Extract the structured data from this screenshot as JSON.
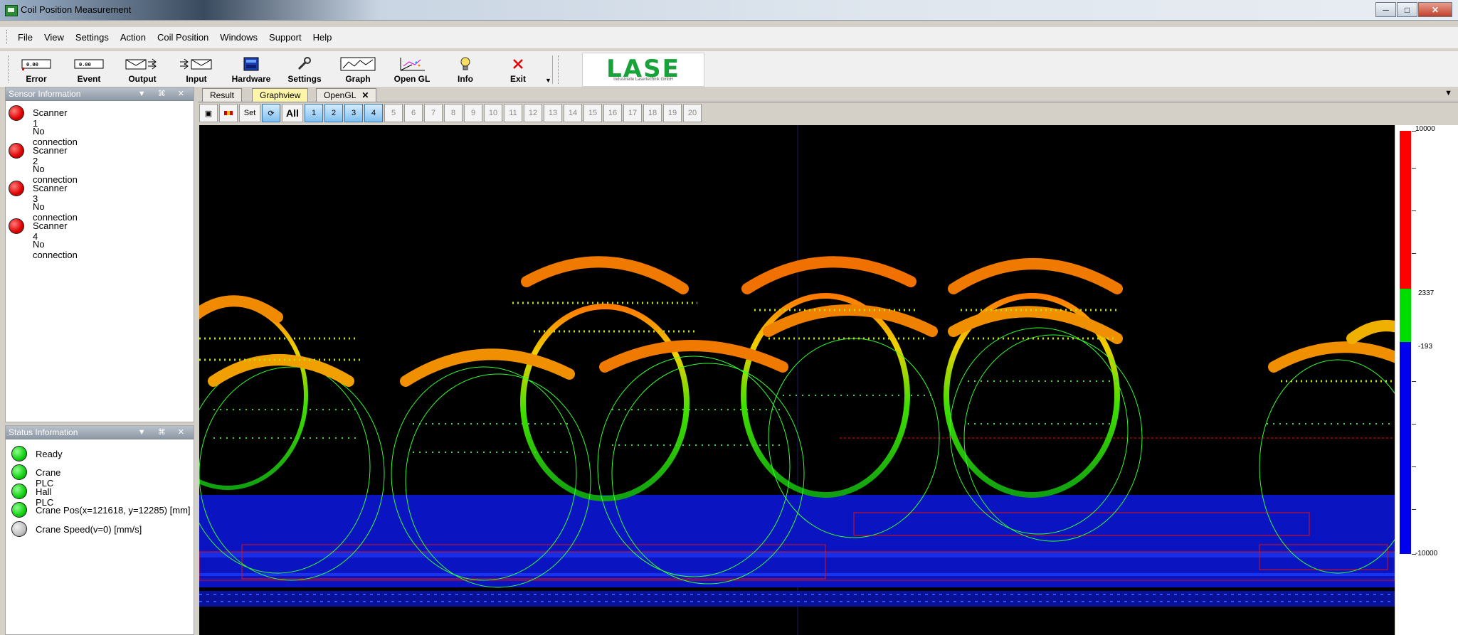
{
  "window": {
    "title": "Coil Position Measurement"
  },
  "menu": [
    "File",
    "View",
    "Settings",
    "Action",
    "Coil Position",
    "Windows",
    "Support",
    "Help"
  ],
  "toolbar": {
    "error": "Error",
    "event": "Event",
    "output": "Output",
    "input": "Input",
    "hardware": "Hardware",
    "settings": "Settings",
    "graph": "Graph",
    "opengl": "Open GL",
    "info": "Info",
    "exit": "Exit"
  },
  "logo": {
    "text": "LASE",
    "sub": "Industrielle Lasertechnik GmbH"
  },
  "sensor_panel": {
    "title": "Sensor Information",
    "scanners": [
      {
        "name": "Scanner 1",
        "status": "No connection"
      },
      {
        "name": "Scanner 2",
        "status": "No connection"
      },
      {
        "name": "Scanner 3",
        "status": "No connection"
      },
      {
        "name": "Scanner 4",
        "status": "No connection"
      }
    ]
  },
  "status_panel": {
    "title": "Status Information",
    "items": [
      {
        "label": "Ready",
        "state": "green"
      },
      {
        "label": "Crane PLC",
        "state": "green"
      },
      {
        "label": "Hall PLC",
        "state": "green"
      },
      {
        "label": "Crane Pos(x=121618, y=12285) [mm]",
        "state": "green"
      },
      {
        "label": "Crane Speed(v=0) [mm/s]",
        "state": "gray"
      }
    ]
  },
  "tabs": {
    "result": "Result",
    "graphview": "Graphview",
    "opengl": "OpenGL"
  },
  "graph_toolbar": {
    "set": "Set",
    "all": "All",
    "numbers": [
      "1",
      "2",
      "3",
      "4",
      "5",
      "6",
      "7",
      "8",
      "9",
      "10",
      "11",
      "12",
      "13",
      "14",
      "15",
      "16",
      "17",
      "18",
      "19",
      "20"
    ]
  },
  "scale": {
    "max": "10000",
    "upper": "2337",
    "lower": "-193",
    "min": "-10000"
  },
  "colors": {
    "red": "#ff0000",
    "green": "#00dd00",
    "blue": "#0000ee",
    "accent": "#18a33a"
  }
}
